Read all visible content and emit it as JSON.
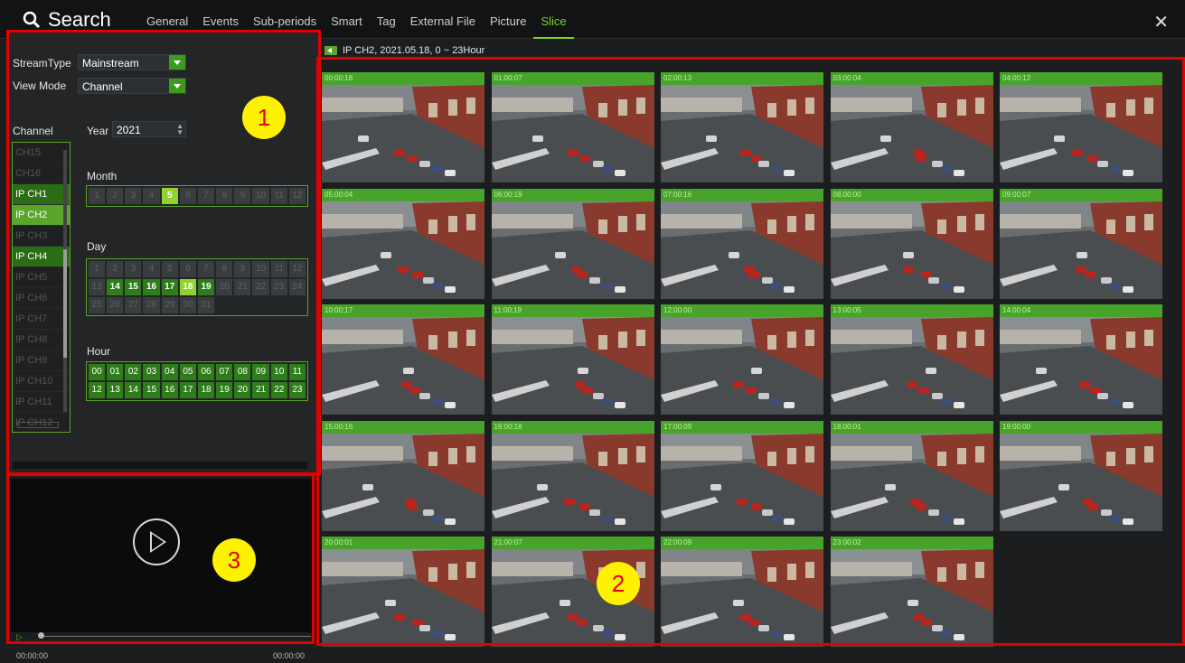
{
  "app": {
    "title": "Search"
  },
  "tabs": [
    "General",
    "Events",
    "Sub-periods",
    "Smart",
    "Tag",
    "External File",
    "Picture",
    "Slice"
  ],
  "active_tab": "Slice",
  "left": {
    "stream_type_label": "StreamType",
    "stream_type_value": "Mainstream",
    "view_mode_label": "View Mode",
    "view_mode_value": "Channel",
    "channel_label": "Channel",
    "year_label": "Year",
    "year_value": "2021",
    "month_label": "Month",
    "day_label": "Day",
    "hour_label": "Hour",
    "channels": [
      {
        "name": "CH15",
        "state": "off"
      },
      {
        "name": "CH16",
        "state": "off"
      },
      {
        "name": "IP CH1",
        "state": "on"
      },
      {
        "name": "IP CH2",
        "state": "selected"
      },
      {
        "name": "IP CH3",
        "state": "off"
      },
      {
        "name": "IP CH4",
        "state": "on"
      },
      {
        "name": "IP CH5",
        "state": "off"
      },
      {
        "name": "IP CH6",
        "state": "off"
      },
      {
        "name": "IP CH7",
        "state": "off"
      },
      {
        "name": "IP CH8",
        "state": "off"
      },
      {
        "name": "IP CH9",
        "state": "off"
      },
      {
        "name": "IP CH10",
        "state": "off"
      },
      {
        "name": "IP CH11",
        "state": "off"
      },
      {
        "name": "IP CH12",
        "state": "off"
      }
    ],
    "months": [
      "1",
      "2",
      "3",
      "4",
      "5",
      "6",
      "7",
      "8",
      "9",
      "10",
      "11",
      "12"
    ],
    "month_selected": "5",
    "days": [
      "1",
      "2",
      "3",
      "4",
      "5",
      "6",
      "7",
      "8",
      "9",
      "10",
      "11",
      "12",
      "13",
      "14",
      "15",
      "16",
      "17",
      "18",
      "19",
      "20",
      "21",
      "22",
      "23",
      "24",
      "25",
      "26",
      "27",
      "28",
      "29",
      "30",
      "31"
    ],
    "days_enabled": [
      "14",
      "15",
      "16",
      "17",
      "19"
    ],
    "day_selected": "18",
    "hours": [
      "00",
      "01",
      "02",
      "03",
      "04",
      "05",
      "06",
      "07",
      "08",
      "09",
      "10",
      "11",
      "12",
      "13",
      "14",
      "15",
      "16",
      "17",
      "18",
      "19",
      "20",
      "21",
      "22",
      "23"
    ]
  },
  "player": {
    "time_start": "00:00:00",
    "time_end": "00:00:00"
  },
  "slice_header": "IP CH2,  2021.05.18,  0 ~ 23Hour",
  "thumbnails": [
    "00:00:18",
    "01:00:07",
    "02:00:13",
    "03:00:04",
    "04:00:12",
    "05:00:04",
    "06:00:19",
    "07:00:16",
    "08:00:00",
    "09:00:07",
    "10:00:17",
    "11:00:19",
    "12:00:00",
    "13:00:05",
    "14:00:04",
    "15:00:16",
    "16:00:18",
    "17:00:09",
    "18:00:01",
    "19:00:00",
    "20:00:01",
    "21:00:07",
    "22:00:09",
    "23:00:02"
  ],
  "annotations": [
    "1",
    "2",
    "3"
  ],
  "colors": {
    "accent": "#5aa52a",
    "highlight": "#e30000",
    "badge": "#fff200"
  }
}
